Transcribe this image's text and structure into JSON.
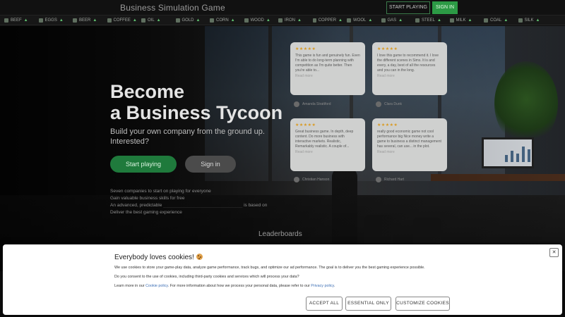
{
  "topbar": {
    "brand": "Business Simulation Game",
    "start_label": "START PLAYING",
    "signin_label": "SIGN IN"
  },
  "ticker": [
    {
      "label": "BEEF",
      "arrow": "▲"
    },
    {
      "label": "EGGS",
      "arrow": "▲"
    },
    {
      "label": "BEER",
      "arrow": "▲"
    },
    {
      "label": "COFFEE",
      "arrow": "▲"
    },
    {
      "label": "OIL",
      "arrow": "▲"
    },
    {
      "label": "GOLD",
      "arrow": "▲"
    },
    {
      "label": "CORN",
      "arrow": "▲"
    },
    {
      "label": "WOOD",
      "arrow": "▲"
    },
    {
      "label": "IRON",
      "arrow": "▲"
    },
    {
      "label": "COPPER",
      "arrow": "▲"
    },
    {
      "label": "WOOL",
      "arrow": "▲"
    },
    {
      "label": "GAS",
      "arrow": "▲"
    },
    {
      "label": "STEEL",
      "arrow": "▲"
    },
    {
      "label": "MILK",
      "arrow": "▲"
    },
    {
      "label": "COAL",
      "arrow": "▲"
    },
    {
      "label": "SILK",
      "arrow": "▲"
    }
  ],
  "hero": {
    "headline_line1": "Become",
    "headline_line2": "a Business Tycoon",
    "subline": "Build your own company from the ground up. Interested?",
    "play_label": "Start playing",
    "signin_label": "Sign in",
    "features": [
      "Seven companies to start on playing for everyone",
      "Gain valuable business skills for free",
      "An advanced, predictable",
      "is based on",
      "Deliver the best gaming experience"
    ]
  },
  "reviews": [
    {
      "stars": "★★★★★",
      "text": "This game is fun and genuinely fun. Even I'm able to do long-term planning with competition as I'm quite better. Then you're able to...",
      "more": "Read more",
      "author": "Amanda Strattford"
    },
    {
      "stars": "★★★★★",
      "text": "I love this game to recommend it. I love the different scenes in Sims. It is and every, a day, best of all the resources and you can in the long.",
      "more": "Read more",
      "author": "Clara Dunk"
    },
    {
      "stars": "★★★★★",
      "text": "Great business game. In depth, deep content. Do more business with interactive markets. Realistic, Remarkably realistic. A couple of...",
      "more": "Read more",
      "author": "Christian Hanson"
    },
    {
      "stars": "★★★★★",
      "text": "really good economic game not cool performance big Nice money write a game to business a distinct management has several, can use... in the plot.",
      "more": "Read more",
      "author": "Richard Hart"
    }
  ],
  "leaderboards": "Leaderboards",
  "cookie": {
    "title": "Everybody loves cookies!",
    "line1": "We use cookies to store your game-play data, analyze game performance, track bugs, and optimize our ad performance. The goal is to deliver you the best gaming experience possible.",
    "line2": "Do you consent to the use of cookies, including third-party cookies and services which will process your data?",
    "line3_prefix": "Learn more in our",
    "cookie_policy": "Cookie policy",
    "line3_middle": ". For more information about how we process your personal data, please refer to our",
    "privacy_policy": "Privacy policy",
    "line3_suffix": ".",
    "close": "✕",
    "accept_all": "ACCEPT ALL",
    "essential_only": "ESSENTIAL ONLY",
    "customize": "CUSTOMIZE COOKIES"
  },
  "colors": {
    "accent": "#2c9a45",
    "play_button": "#1f7a3c",
    "star": "#d99a22",
    "link": "#3d6fb5"
  }
}
